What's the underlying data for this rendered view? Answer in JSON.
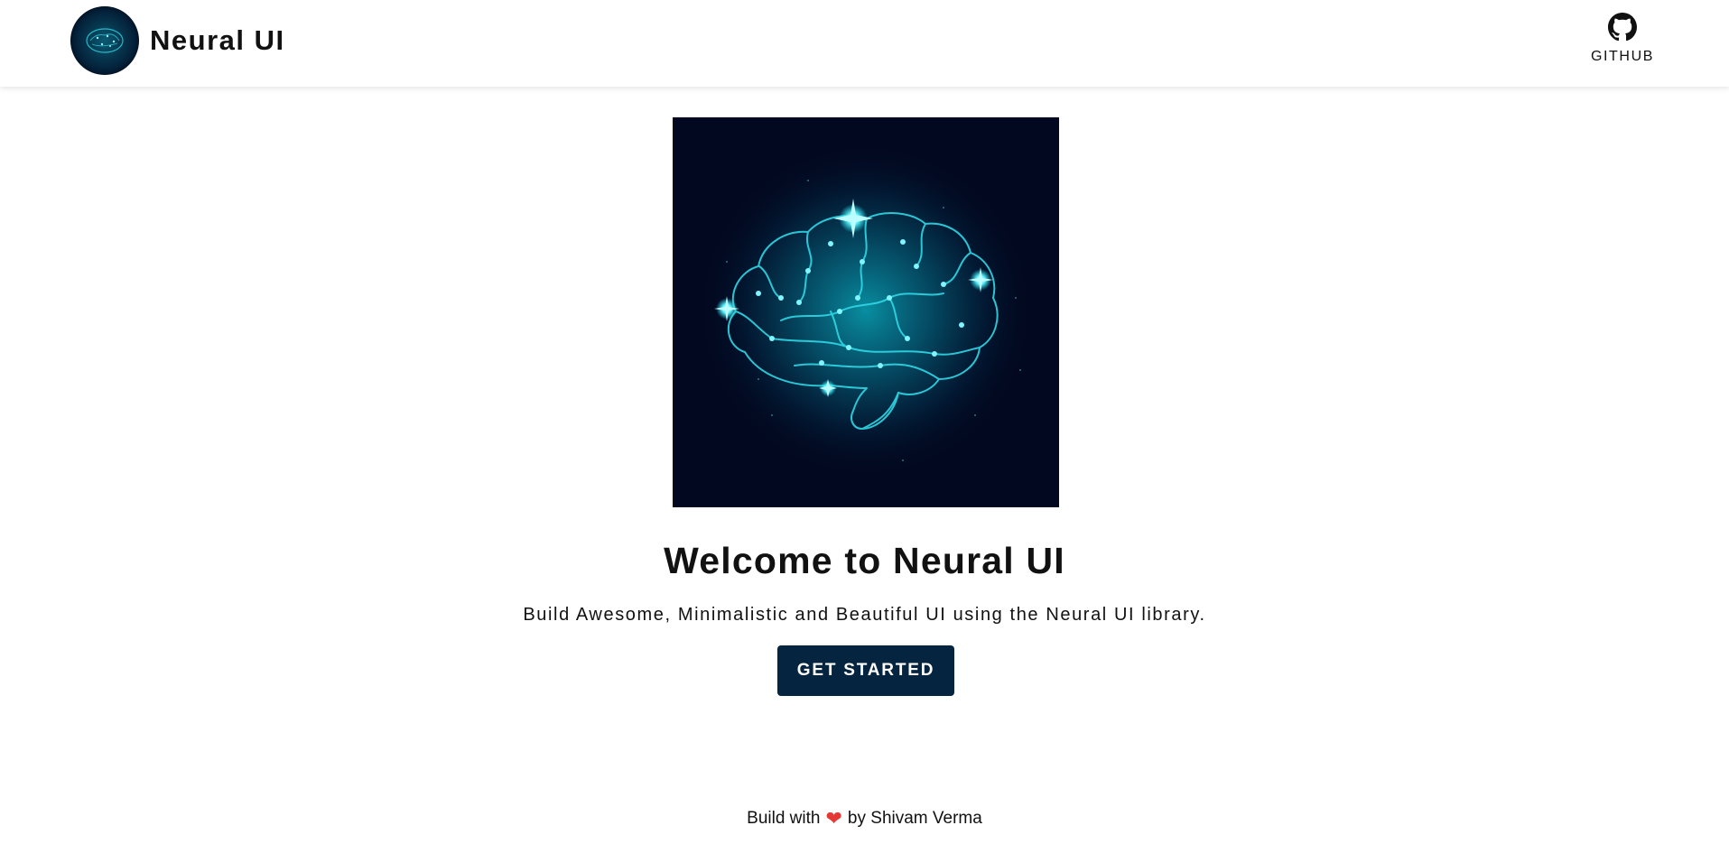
{
  "navbar": {
    "brand_name": "Neural UI",
    "brand_logo_icon": "brain-logo-icon",
    "github_label": "GITHUB",
    "github_icon": "github-icon"
  },
  "hero": {
    "image_icon": "glowing-brain-illustration",
    "title": "Welcome to Neural UI",
    "subtitle": "Build Awesome, Minimalistic and Beautiful UI using the Neural UI library.",
    "cta_label": "GET STARTED"
  },
  "footer": {
    "prefix": "Build with",
    "heart_icon": "heart-icon",
    "suffix": "by Shivam Verma"
  },
  "colors": {
    "primary": "#05243f",
    "hero_background": "#02081f",
    "glow": "#1fe0f0",
    "heart": "#e53935",
    "text": "#111111"
  }
}
